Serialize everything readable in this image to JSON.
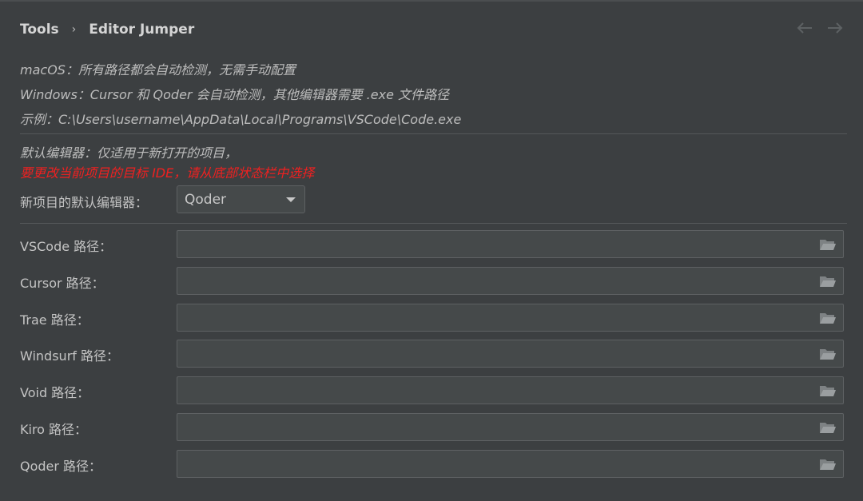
{
  "header": {
    "root": "Tools",
    "separator": "›",
    "title": "Editor Jumper",
    "back_icon": "arrow-left-icon",
    "forward_icon": "arrow-right-icon"
  },
  "info": {
    "mac_line": "macOS：所有路径都会自动检测，无需手动配置",
    "windows_line": "Windows：Cursor 和 Qoder 会自动检测，其他编辑器需要 .exe 文件路径",
    "example_line": "示例：C:\\Users\\username\\AppData\\Local\\Programs\\VSCode\\Code.exe"
  },
  "default_editor": {
    "note": "默认编辑器：仅适用于新打开的项目，",
    "warning": "要更改当前项目的目标 IDE，请从底部状态栏中选择",
    "warning_color": "#f02020",
    "label": "新项目的默认编辑器：",
    "selected": "Qoder"
  },
  "paths": [
    {
      "label": "VSCode 路径：",
      "value": ""
    },
    {
      "label": "Cursor 路径：",
      "value": ""
    },
    {
      "label": "Trae 路径：",
      "value": ""
    },
    {
      "label": "Windsurf 路径：",
      "value": ""
    },
    {
      "label": "Void 路径：",
      "value": ""
    },
    {
      "label": "Kiro 路径：",
      "value": ""
    },
    {
      "label": "Qoder 路径：",
      "value": ""
    }
  ],
  "icons": {
    "folder": "folder-open-icon",
    "dropdown": "chevron-down-icon"
  },
  "colors": {
    "background": "#3c3f41",
    "field": "#45494a",
    "border": "#5e6163",
    "text": "#bbbbbb"
  }
}
